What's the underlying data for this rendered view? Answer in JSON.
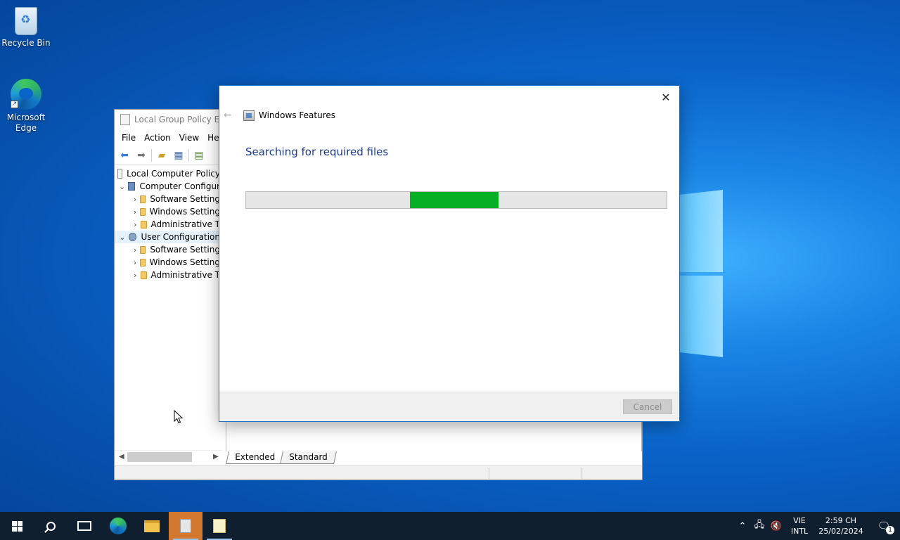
{
  "desktop": {
    "icons": [
      {
        "label": "Recycle Bin"
      },
      {
        "label": "Microsoft Edge"
      }
    ]
  },
  "gpedit": {
    "title": "Local Group Policy Edi",
    "menu": [
      "File",
      "Action",
      "View",
      "He"
    ],
    "tree": [
      {
        "label": "Local Computer Policy",
        "level": 0
      },
      {
        "label": "Computer Configur",
        "level": 1
      },
      {
        "label": "Software Setting",
        "level": 2
      },
      {
        "label": "Windows Setting",
        "level": 2
      },
      {
        "label": "Administrative T",
        "level": 2
      },
      {
        "label": "User Configuration",
        "level": 1
      },
      {
        "label": "Software Setting",
        "level": 2
      },
      {
        "label": "Windows Setting",
        "level": 2
      },
      {
        "label": "Administrative T",
        "level": 2
      }
    ],
    "tabs": [
      "Extended",
      "Standard"
    ]
  },
  "features_dialog": {
    "title": "Windows Features",
    "heading": "Searching for required files",
    "progress_fill_color": "#06b025",
    "progress_fill_start": 0.39,
    "progress_fill_end": 0.6,
    "cancel_label": "Cancel",
    "close_glyph": "✕"
  },
  "taskbar": {
    "language": {
      "line1": "VIE",
      "line2": "INTL"
    },
    "clock": {
      "time": "2:59 CH",
      "date": "25/02/2024"
    },
    "notification_count": "1"
  }
}
